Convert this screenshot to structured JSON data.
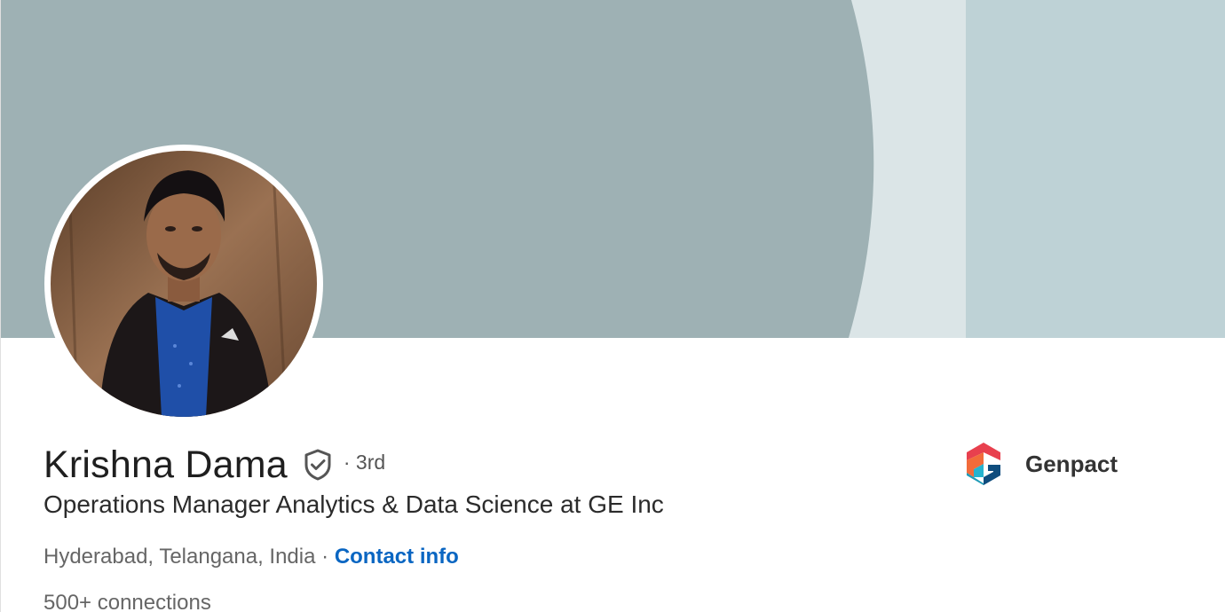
{
  "profile": {
    "name": "Krishna Dama",
    "degree": "· 3rd",
    "headline": "Operations Manager Analytics & Data Science at GE Inc",
    "location": "Hyderabad, Telangana, India",
    "separator": "·",
    "contact_label": "Contact info",
    "connections": "500+ connections"
  },
  "company": {
    "name": "Genpact",
    "logo_icon": "genpact-logo-icon"
  },
  "icons": {
    "verified": "verified-shield-icon"
  },
  "colors": {
    "link": "#0a66c2",
    "banner_dark": "#9eb1b4",
    "banner_light": "#dbe5e7",
    "banner_right": "#bed2d6"
  }
}
